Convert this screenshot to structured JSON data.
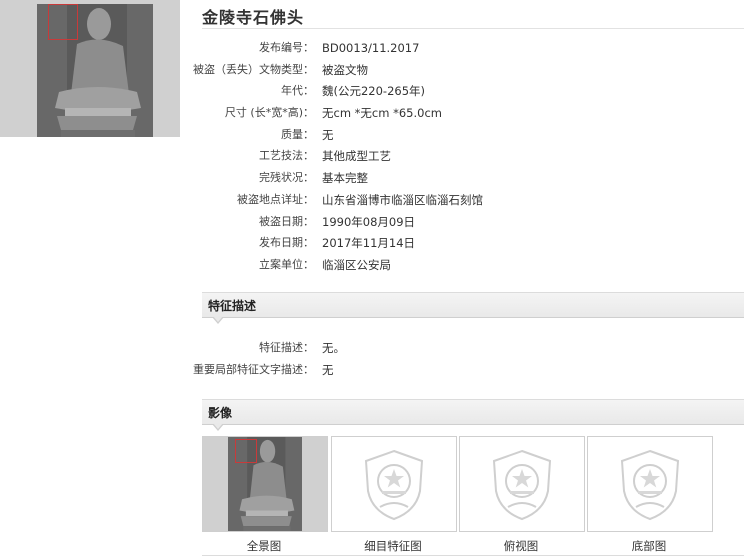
{
  "title": "金陵寺石佛头",
  "info": [
    {
      "label": "发布编号：",
      "value": "BD0013/11.2017"
    },
    {
      "label": "被盗（丢失）文物类型：",
      "value": "被盗文物"
    },
    {
      "label": "年代：",
      "value": "魏(公元220-265年)"
    },
    {
      "label": "尺寸 (长*宽*高)：",
      "value": "无cm *无cm *65.0cm"
    },
    {
      "label": "质量：",
      "value": "无"
    },
    {
      "label": "工艺技法：",
      "value": "其他成型工艺"
    },
    {
      "label": "完残状况：",
      "value": "基本完整"
    },
    {
      "label": "被盗地点详址：",
      "value": "山东省淄博市临淄区临淄石刻馆"
    },
    {
      "label": "被盗日期：",
      "value": "1990年08月09日"
    },
    {
      "label": "发布日期：",
      "value": "2017年11月14日"
    },
    {
      "label": "立案单位：",
      "value": "临淄区公安局"
    }
  ],
  "features_section": {
    "title": "特征描述",
    "rows": [
      {
        "label": "特征描述：",
        "value": "无。"
      },
      {
        "label": "重要局部特征文字描述：",
        "value": "无"
      }
    ]
  },
  "images_section": {
    "title": "影像",
    "items": [
      {
        "caption": "全景图",
        "kind": "photo"
      },
      {
        "caption": "细目特征图",
        "kind": "emblem"
      },
      {
        "caption": "俯视图",
        "kind": "emblem"
      },
      {
        "caption": "底部图",
        "kind": "emblem"
      }
    ]
  }
}
